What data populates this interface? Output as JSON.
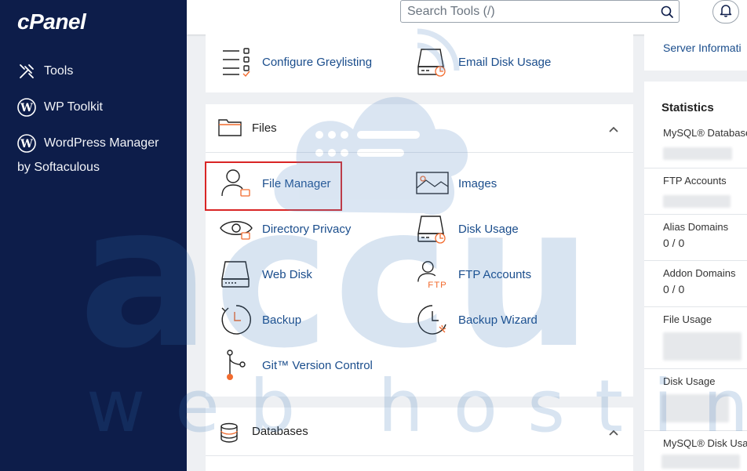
{
  "app": {
    "logo": "cPanel"
  },
  "sidebar": {
    "items": [
      {
        "label": "Tools",
        "icon": "tools-icon"
      },
      {
        "label": "WP Toolkit",
        "icon": "wordpress-icon"
      },
      {
        "label": "WordPress Manager",
        "icon": "wordpress-icon"
      }
    ],
    "wordpress_manager_sub": "by Softaculous"
  },
  "topbar": {
    "search_placeholder": "Search Tools (/)"
  },
  "email_section": {
    "tools": [
      {
        "label": "Configure Greylisting",
        "icon": "checklist-icon"
      },
      {
        "label": "Email Disk Usage",
        "icon": "disk-usage-icon"
      }
    ]
  },
  "files_section": {
    "title": "Files",
    "tools": [
      {
        "label": "File Manager",
        "icon": "file-manager-icon"
      },
      {
        "label": "Images",
        "icon": "images-icon"
      },
      {
        "label": "Directory Privacy",
        "icon": "directory-privacy-icon"
      },
      {
        "label": "Disk Usage",
        "icon": "disk-usage-icon"
      },
      {
        "label": "Web Disk",
        "icon": "web-disk-icon"
      },
      {
        "label": "FTP Accounts",
        "icon": "ftp-accounts-icon"
      },
      {
        "label": "Backup",
        "icon": "backup-icon"
      },
      {
        "label": "Backup Wizard",
        "icon": "backup-wizard-icon"
      },
      {
        "label": "Git™ Version Control",
        "icon": "git-icon"
      }
    ]
  },
  "databases_section": {
    "title": "Databases"
  },
  "right_panel": {
    "server_info_link": "Server Informati",
    "statistics_title": "Statistics",
    "stats": [
      {
        "label": "MySQL® Database",
        "value": ""
      },
      {
        "label": "FTP Accounts",
        "value": ""
      },
      {
        "label": "Alias Domains",
        "value": "0 / 0"
      },
      {
        "label": "Addon Domains",
        "value": "0 / 0"
      },
      {
        "label": "File Usage",
        "value": ""
      },
      {
        "label": "Disk Usage",
        "value": ""
      },
      {
        "label": "MySQL® Disk Usag",
        "value": ""
      }
    ]
  },
  "watermark": {
    "line1": "accu",
    "line2": "web hosting"
  },
  "colors": {
    "sidebar_bg": "#0d1d4a",
    "link": "#1a4d8c",
    "highlight": "#d92525",
    "icon_accent": "#f26b2e"
  }
}
